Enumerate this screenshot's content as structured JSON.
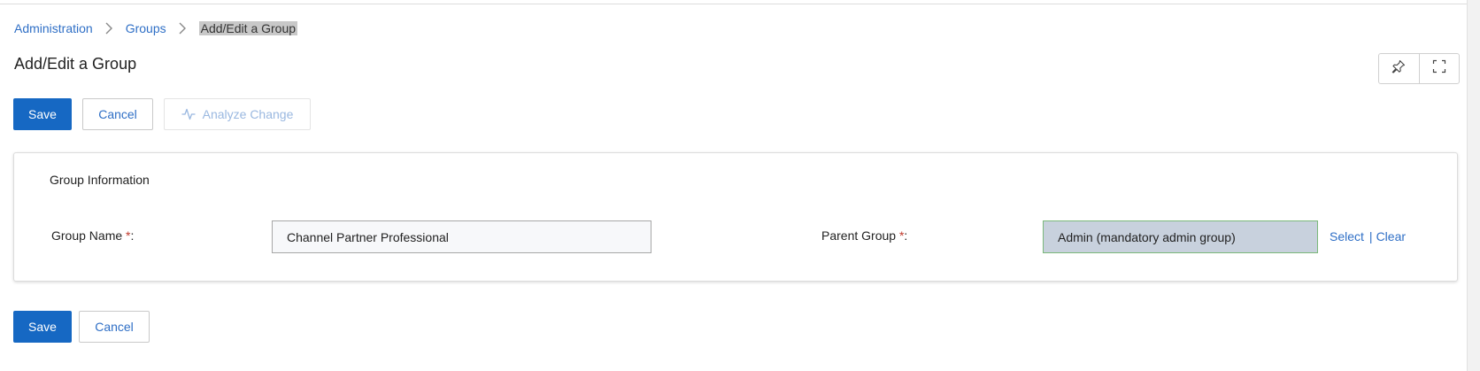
{
  "breadcrumb": {
    "items": [
      "Administration",
      "Groups"
    ],
    "current": "Add/Edit a Group"
  },
  "page": {
    "title": "Add/Edit a Group"
  },
  "top_actions": {
    "save_label": "Save",
    "cancel_label": "Cancel",
    "analyze_label": "Analyze Change"
  },
  "toolbar_icons": [
    "pin-icon",
    "expand-icon"
  ],
  "group_info": {
    "title": "Group Information",
    "group_name_label": "Group Name ",
    "group_name_value": "Channel Partner Professional",
    "parent_group_label": "Parent Group ",
    "parent_group_value": "Admin (mandatory admin group)",
    "required_mark": "*",
    "label_colon": ":",
    "select_label": "Select",
    "link_separator": "|",
    "clear_label": "Clear"
  },
  "bottom_actions": {
    "save_label": "Save",
    "cancel_label": "Cancel"
  },
  "colors": {
    "primary": "#1668c3",
    "link": "#2f6fc6",
    "required": "#c0392b",
    "readonly_bg": "#c8d1dd",
    "readonly_border": "#7ab87a"
  }
}
